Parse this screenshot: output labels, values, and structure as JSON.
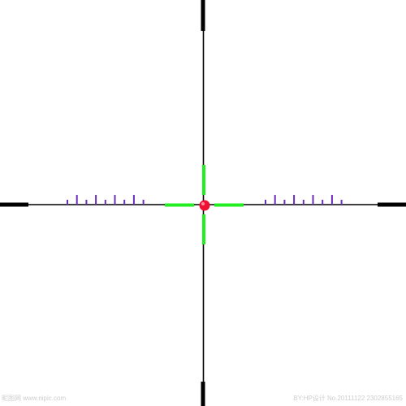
{
  "reticle": {
    "line_color": "#000000",
    "post_color": "#000000",
    "center_color": "#22ee22",
    "dot_color": "#ee1133",
    "dot_highlight_color": "#ffb0c0",
    "hash_color": "#6a2fb8"
  },
  "watermark": {
    "left_text": "昵图网 www.nipic.com",
    "right_text": "BY:HP设计 No.20111122 2302855165"
  }
}
